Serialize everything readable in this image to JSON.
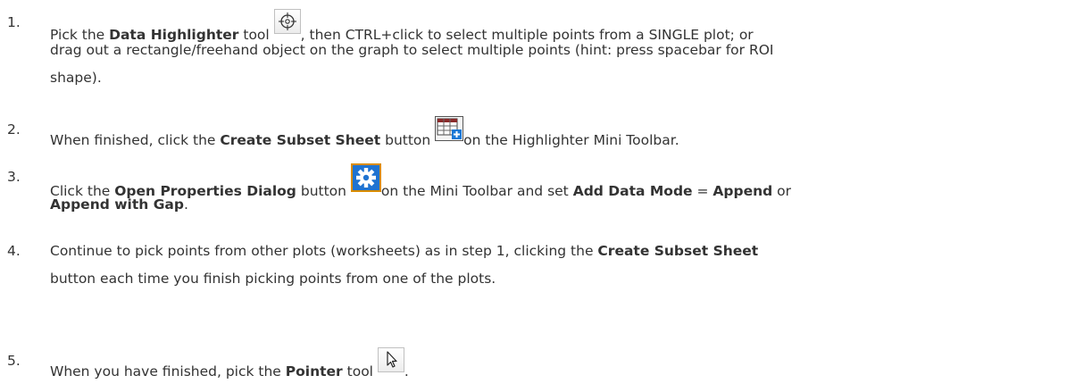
{
  "steps": [
    {
      "number": "1.",
      "parts": {
        "a": "Pick the ",
        "b": "Data Highlighter",
        "c": " tool ",
        "d": ", then CTRL+click to select multiple points from a SINGLE plot; or",
        "line2": "drag out a rectangle/freehand object on the graph to select multiple points (hint: press spacebar for ROI",
        "line3": "shape)."
      },
      "icon": "data-highlighter-icon"
    },
    {
      "number": "2.",
      "parts": {
        "a": "When finished, click the ",
        "b": "Create Subset Sheet",
        "c": " button ",
        "d": "on the Highlighter Mini Toolbar."
      },
      "icon": "create-subset-sheet-icon"
    },
    {
      "number": "3.",
      "parts": {
        "a": "Click the ",
        "b": "Open Properties Dialog",
        "c": " button ",
        "d": "on the Mini Toolbar and set ",
        "e": "Add Data Mode",
        "f": " = ",
        "g": "Append",
        "h": " or",
        "i": "Append with Gap",
        "j": "."
      },
      "icon": "gear-icon"
    },
    {
      "number": "4.",
      "parts": {
        "a": "Continue to pick points from other plots (worksheets) as in step 1, clicking the ",
        "b": "Create Subset Sheet",
        "line2": "button each time you finish picking points from one of the plots."
      }
    },
    {
      "number": "5.",
      "parts": {
        "a": "When you have finished, pick the ",
        "b": "Pointer",
        "c": " tool ",
        "d": "."
      },
      "icon": "pointer-arrow-icon"
    }
  ],
  "colors": {
    "text": "#333333",
    "gear_bg": "#1f73d1",
    "gear_border": "#d98c00",
    "plus": "#1a78d6"
  }
}
